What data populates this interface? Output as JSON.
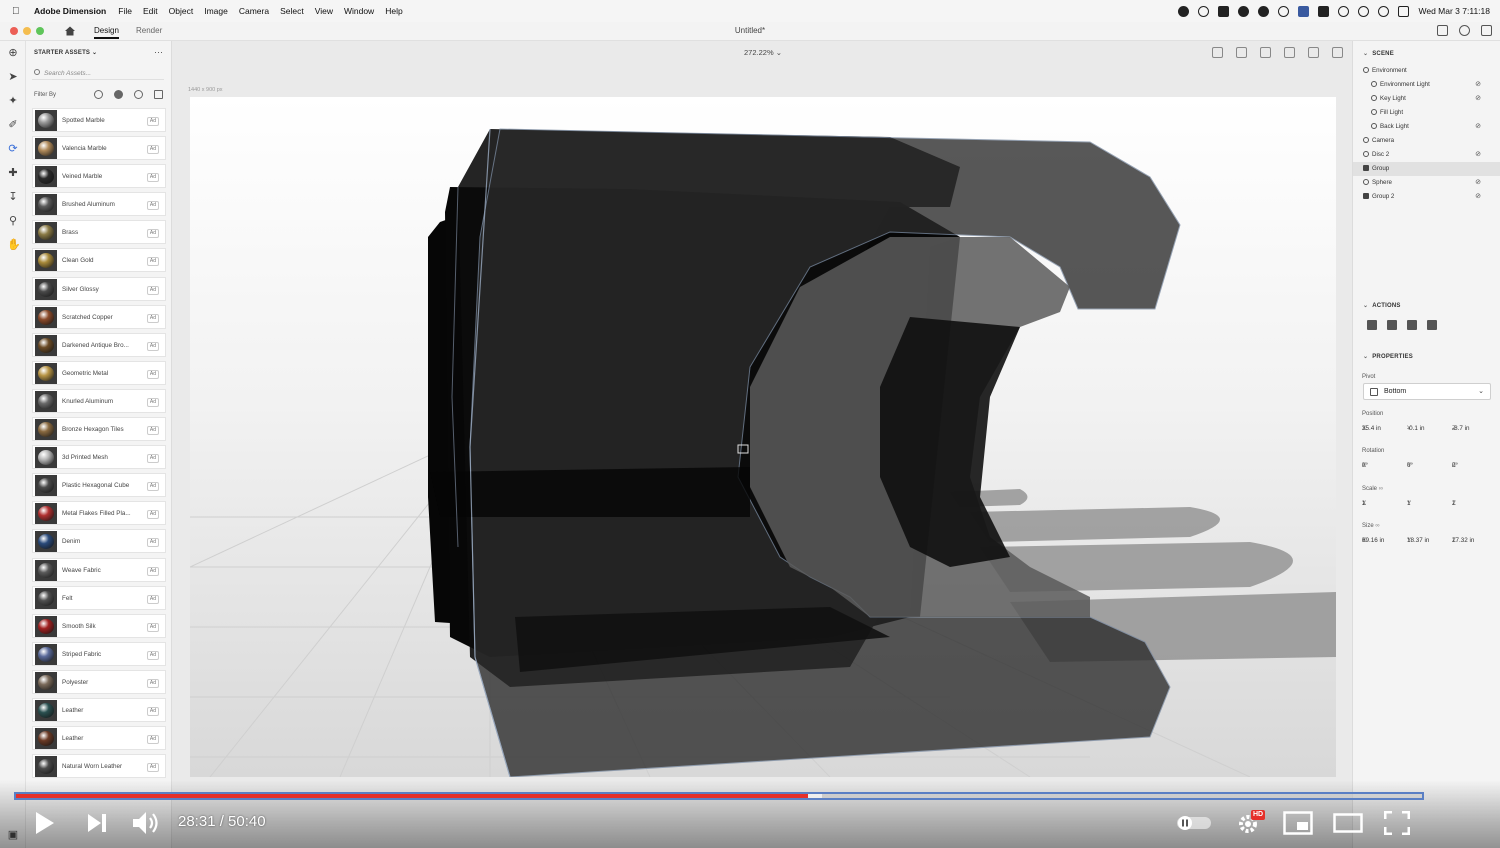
{
  "menubar": {
    "app_name": "Adobe Dimension",
    "menus": [
      "File",
      "Edit",
      "Object",
      "Image",
      "Camera",
      "Select",
      "View",
      "Window",
      "Help"
    ],
    "clock": "Wed Mar 3  7:11:18"
  },
  "titlebar": {
    "tabs": [
      "Design",
      "Render"
    ],
    "active_tab": "Design",
    "document_title": "Untitled*"
  },
  "assets": {
    "header": "STARTER ASSETS",
    "search_placeholder": "Search Assets...",
    "filter_label": "Filter By",
    "badge_label": "Ad",
    "items": [
      {
        "name": "Spotted Marble",
        "color": "#9a9a9a"
      },
      {
        "name": "Valencia Marble",
        "color": "#b08a5a"
      },
      {
        "name": "Veined Marble",
        "color": "#2a2a2a"
      },
      {
        "name": "Brushed Aluminum",
        "color": "#5a5a5a"
      },
      {
        "name": "Brass",
        "color": "#8a7a45"
      },
      {
        "name": "Clean Gold",
        "color": "#a88a3a"
      },
      {
        "name": "Silver Glossy",
        "color": "#4a4a4a"
      },
      {
        "name": "Scratched Copper",
        "color": "#8a4a2a"
      },
      {
        "name": "Darkened Antique Bro...",
        "color": "#6a4a25"
      },
      {
        "name": "Geometric Metal",
        "color": "#b89545"
      },
      {
        "name": "Knurled Aluminum",
        "color": "#6a6a6a"
      },
      {
        "name": "Bronze Hexagon Tiles",
        "color": "#8a6a40"
      },
      {
        "name": "3d Printed Mesh",
        "color": "#b8b8b8"
      },
      {
        "name": "Plastic Hexagonal Cube",
        "color": "#4a4a4a"
      },
      {
        "name": "Metal Flakes Filled Pla...",
        "color": "#b03030"
      },
      {
        "name": "Denim",
        "color": "#2a4a7a"
      },
      {
        "name": "Weave Fabric",
        "color": "#5a5a5a"
      },
      {
        "name": "Felt",
        "color": "#505050"
      },
      {
        "name": "Smooth Silk",
        "color": "#a02020"
      },
      {
        "name": "Striped Fabric",
        "color": "#5a6a9a"
      },
      {
        "name": "Polyester",
        "color": "#7a6a5a"
      },
      {
        "name": "Leather",
        "color": "#2a5050"
      },
      {
        "name": "Leather",
        "color": "#6a3a25"
      },
      {
        "name": "Natural Worn Leather",
        "color": "#4a4a4a"
      }
    ]
  },
  "viewport": {
    "zoom": "272.22%",
    "canvas_size": "1440 x 900 px"
  },
  "scene": {
    "header": "SCENE",
    "items": [
      {
        "name": "Environment",
        "level": 0,
        "icon": "environment-icon",
        "hidden": false
      },
      {
        "name": "Environment Light",
        "level": 1,
        "icon": "light-icon",
        "hidden": true
      },
      {
        "name": "Key Light",
        "level": 1,
        "icon": "sun-icon",
        "hidden": true
      },
      {
        "name": "Fill Light",
        "level": 1,
        "icon": "sun-icon",
        "hidden": false
      },
      {
        "name": "Back Light",
        "level": 1,
        "icon": "sun-icon",
        "hidden": true
      },
      {
        "name": "Camera",
        "level": 0,
        "icon": "camera-icon",
        "hidden": false
      },
      {
        "name": "Disc 2",
        "level": 0,
        "icon": "disc-icon",
        "hidden": true
      },
      {
        "name": "Group",
        "level": 0,
        "icon": "folder-icon",
        "hidden": false,
        "selected": true
      },
      {
        "name": "Sphere",
        "level": 0,
        "icon": "sphere-icon",
        "hidden": true
      },
      {
        "name": "Group 2",
        "level": 0,
        "icon": "folder-icon",
        "hidden": true
      }
    ]
  },
  "actions": {
    "header": "ACTIONS"
  },
  "properties": {
    "header": "PROPERTIES",
    "pivot_label": "Pivot",
    "pivot_value": "Bottom",
    "position_label": "Position",
    "position": {
      "x": "35.4 in",
      "y": "-0.1 in",
      "z": "-8.7 in"
    },
    "rotation_label": "Rotation",
    "rotation": {
      "x": "0°",
      "y": "0°",
      "z": "0°"
    },
    "scale_label": "Scale",
    "scale": {
      "x": "1",
      "y": "1",
      "z": "1"
    },
    "size_label": "Size",
    "size": {
      "x": "69.16 in",
      "y": "18.37 in",
      "z": "17.32 in"
    }
  },
  "video": {
    "current_time": "28:31",
    "duration": "50:40",
    "time_display": "28:31 / 50:40",
    "played_fraction": 0.563,
    "buffered_fraction": 0.573,
    "quality_badge": "HD"
  },
  "colors": {
    "progress_played": "#e5302a",
    "progress_border": "#5a7fc4",
    "selected_row": "#e1e1e1"
  }
}
